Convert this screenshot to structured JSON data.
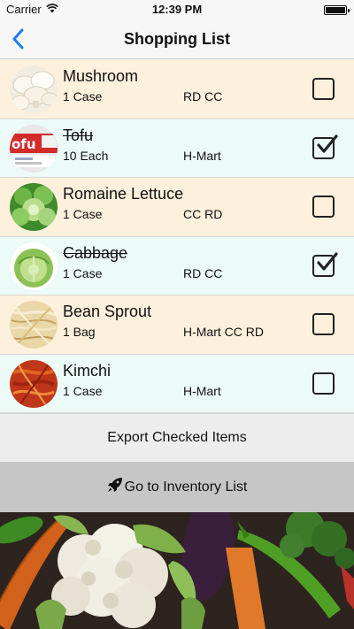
{
  "status_bar": {
    "carrier": "Carrier",
    "time": "12:39 PM",
    "wifi_icon": "wifi-icon",
    "battery_icon": "battery-icon"
  },
  "nav": {
    "title": "Shopping List",
    "back_icon": "chevron-left-icon"
  },
  "items": [
    {
      "name": "Mushroom",
      "qty": "1 Case",
      "stores": "RD CC",
      "checked": false,
      "image": "mushroom"
    },
    {
      "name": "Tofu",
      "qty": "10 Each",
      "stores": "H-Mart",
      "checked": true,
      "image": "tofu"
    },
    {
      "name": "Romaine Lettuce",
      "qty": "1 Case",
      "stores": "CC RD",
      "checked": false,
      "image": "romaine-lettuce"
    },
    {
      "name": "Cabbage",
      "qty": "1 Case",
      "stores": "RD CC",
      "checked": true,
      "image": "cabbage"
    },
    {
      "name": "Bean Sprout",
      "qty": "1 Bag",
      "stores": "H-Mart CC RD",
      "checked": false,
      "image": "bean-sprout"
    },
    {
      "name": "Kimchi",
      "qty": "1 Case",
      "stores": "H-Mart",
      "checked": false,
      "image": "kimchi"
    }
  ],
  "buttons": {
    "export_label": "Export Checked Items",
    "inventory_label": "Go to Inventory List",
    "inventory_icon": "rocket-icon"
  },
  "colors": {
    "accent": "#1a7cf4",
    "row_odd": "#fdf0dc",
    "row_even": "#ecfbf7",
    "export_bg": "#ededed",
    "inventory_bg": "#c6c6c6"
  }
}
